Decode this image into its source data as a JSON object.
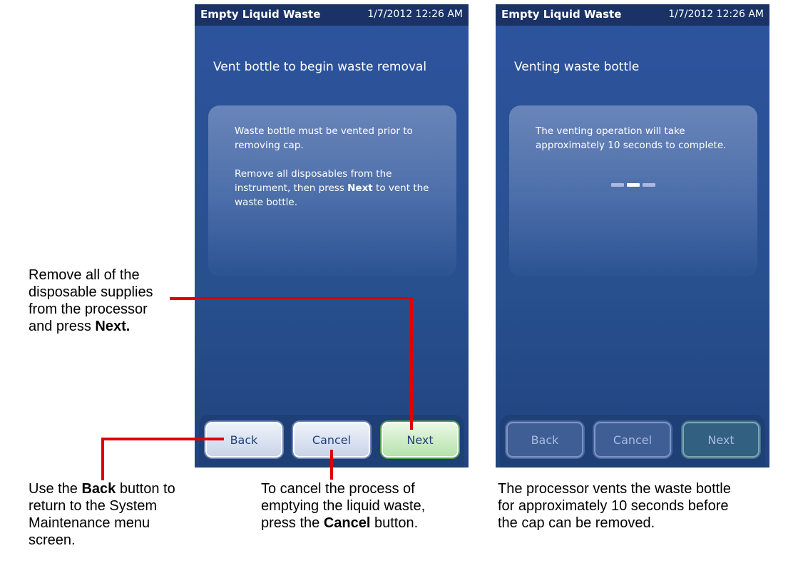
{
  "left_screen": {
    "title": "Empty Liquid Waste",
    "datetime": "1/7/2012 12:26 AM",
    "heading": "Vent bottle to begin waste removal",
    "panel_p1": "Waste bottle must be vented prior to removing cap.",
    "panel_p2_pre": "Remove all disposables from the instrument, then press ",
    "panel_p2_bold": "Next",
    "panel_p2_post": " to vent the waste bottle.",
    "buttons": {
      "back": "Back",
      "cancel": "Cancel",
      "next": "Next"
    }
  },
  "right_screen": {
    "title": "Empty Liquid Waste",
    "datetime": "1/7/2012 12:26 AM",
    "heading": "Venting waste bottle",
    "panel_p1": "The venting operation will take approximately 10 seconds to complete.",
    "buttons": {
      "back": "Back",
      "cancel": "Cancel",
      "next": "Next"
    }
  },
  "annotations": {
    "next_callout": {
      "line1": "Remove all of the",
      "line2": "disposable supplies",
      "line3": "from the processor",
      "line4_pre": "and press ",
      "line4_bold": "Next."
    },
    "back_callout": {
      "line1_pre": "Use the ",
      "line1_bold": "Back",
      "line1_post": " button to",
      "line2": "return to the System",
      "line3": "Maintenance menu",
      "line4": "screen."
    },
    "cancel_callout": {
      "line1": "To cancel the process of",
      "line2": "emptying the liquid waste,",
      "line3_pre": "press the ",
      "line3_bold": "Cancel",
      "line3_post": " button."
    },
    "venting_callout": {
      "line1": "The processor vents the waste bottle",
      "line2": "for approximately 10 seconds before",
      "line3": "the cap can be removed."
    }
  },
  "colors": {
    "screen_bg": "#2d549e",
    "titlebar_bg": "#1a3266",
    "callout_line": "#e00000",
    "progress_active": "#ffffff",
    "progress_inactive": "#a9bbe0"
  },
  "progress_indicator": {
    "segments": 3,
    "active_segment": 2
  }
}
